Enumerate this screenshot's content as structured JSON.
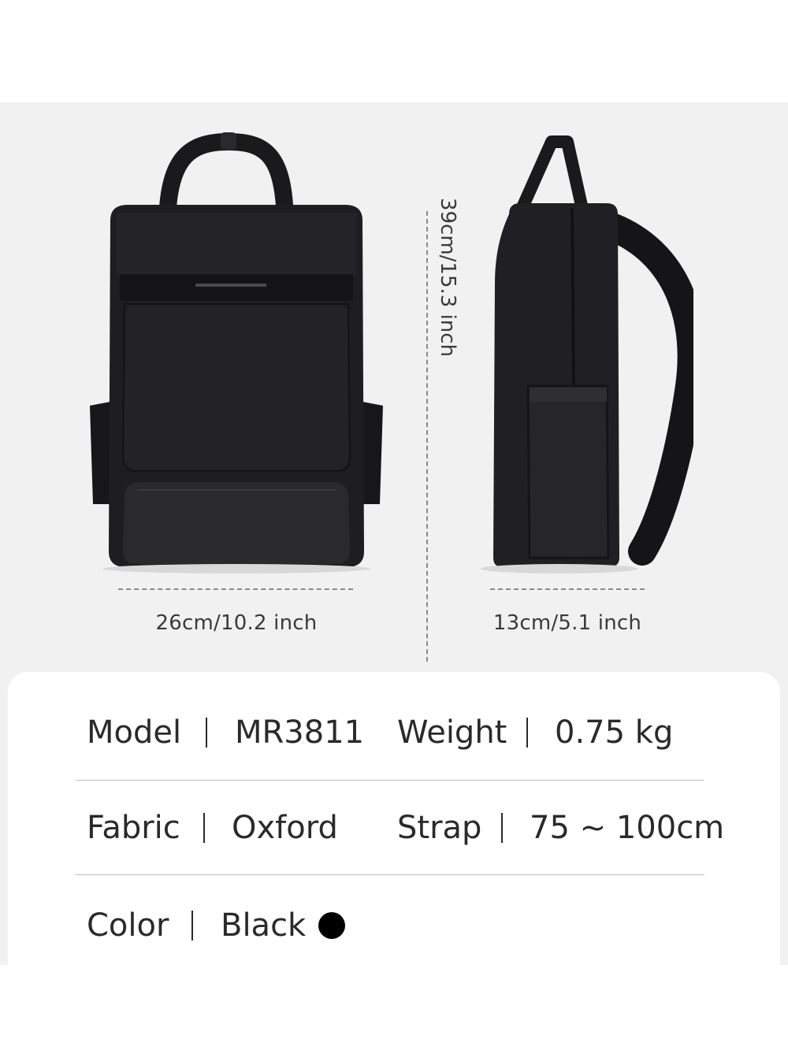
{
  "dimensions": {
    "width": "26cm/10.2 inch",
    "depth": "13cm/5.1 inch",
    "height": "39cm/15.3 inch"
  },
  "specs": {
    "row1": {
      "label1": "Model",
      "value1": "MR3811",
      "label2": "Weight",
      "value2": "0.75 kg"
    },
    "row2": {
      "label1": "Fabric",
      "value1": "Oxford",
      "label2": "Strap",
      "value2": "75 ~ 100cm"
    },
    "row3": {
      "label1": "Color",
      "value1": "Black"
    }
  },
  "colors": {
    "background": "#f1f1f1",
    "card": "#ffffff",
    "bag": "#1c1c1e",
    "color_swatch": "#000000"
  }
}
